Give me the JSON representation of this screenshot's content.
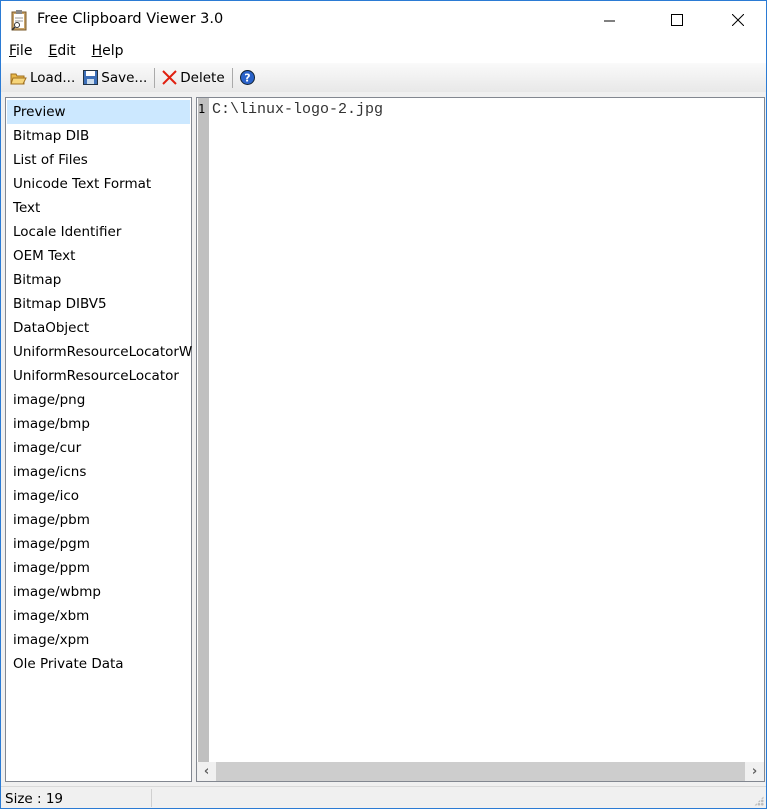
{
  "window": {
    "title": "Free Clipboard Viewer 3.0"
  },
  "menu": [
    {
      "label": "File",
      "accel": "F",
      "rest": "ile"
    },
    {
      "label": "Edit",
      "accel": "E",
      "rest": "dit"
    },
    {
      "label": "Help",
      "accel": "H",
      "rest": "elp"
    }
  ],
  "toolbar": {
    "load": "Load...",
    "save": "Save...",
    "delete": "Delete"
  },
  "formats": [
    "Preview",
    "Bitmap DIB",
    "List of Files",
    "Unicode Text Format",
    "Text",
    "Locale Identifier",
    "OEM Text",
    "Bitmap",
    "Bitmap DIBV5",
    "DataObject",
    "UniformResourceLocatorW",
    "UniformResourceLocator",
    "image/png",
    "image/bmp",
    "image/cur",
    "image/icns",
    "image/ico",
    "image/pbm",
    "image/pgm",
    "image/ppm",
    "image/wbmp",
    "image/xbm",
    "image/xpm",
    "Ole Private Data"
  ],
  "editor": {
    "line_number": "1",
    "content": "C:\\linux-logo-2.jpg"
  },
  "status": {
    "size": "Size : 19"
  }
}
